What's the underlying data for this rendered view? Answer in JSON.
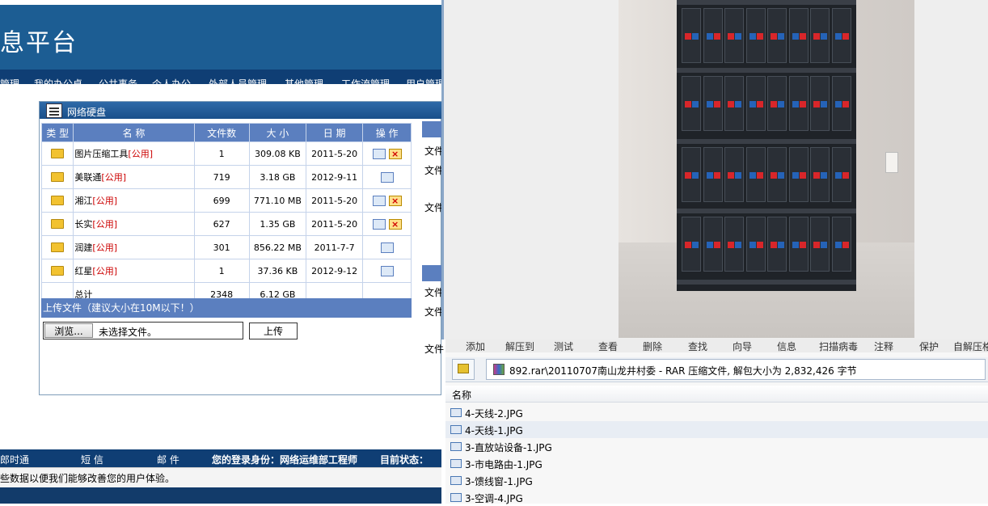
{
  "portal": {
    "banner_title": "息平台",
    "nav": [
      "管理",
      "我的办公桌",
      "公共事务",
      "个人办公",
      "外部人员管理",
      "其他管理",
      "工作流管理",
      "用户管理"
    ],
    "panel_title": "网络硬盘",
    "table": {
      "headers": [
        "类 型",
        "名 称",
        "文件数",
        "大 小",
        "日 期",
        "操 作"
      ],
      "rows": [
        {
          "name": "图片压缩工具",
          "tag": "[公用]",
          "count": "1",
          "size": "309.08 KB",
          "date": "2011-5-20",
          "can_delete": true
        },
        {
          "name": "美联通",
          "tag": "[公用]",
          "count": "719",
          "size": "3.18 GB",
          "date": "2012-9-11",
          "can_delete": false
        },
        {
          "name": "湘江",
          "tag": "[公用]",
          "count": "699",
          "size": "771.10 MB",
          "date": "2011-5-20",
          "can_delete": true
        },
        {
          "name": "长实",
          "tag": "[公用]",
          "count": "627",
          "size": "1.35 GB",
          "date": "2011-5-20",
          "can_delete": true
        },
        {
          "name": "润建",
          "tag": "[公用]",
          "count": "301",
          "size": "856.22 MB",
          "date": "2011-7-7",
          "can_delete": false
        },
        {
          "name": "红星",
          "tag": "[公用]",
          "count": "1",
          "size": "37.36 KB",
          "date": "2012-9-12",
          "can_delete": false
        }
      ],
      "total_label": "总计",
      "total_count": "2348",
      "total_size": "6.12 GB"
    },
    "upload": {
      "header": "上传文件（建议大小在10M以下！）",
      "browse_label": "浏览...",
      "file_status": "未选择文件。",
      "upload_label": "上传"
    },
    "side_labels": [
      "文件",
      "文件",
      "文件",
      "文件",
      "文件",
      "文件"
    ],
    "bottom_bar": {
      "im": "郎时通",
      "sms": "短 信",
      "mail": "邮 件",
      "login": "您的登录身份：网络运维部工程师",
      "status": "目前状态："
    },
    "info_text": "些数据以便我们能够改善您的用户体验。"
  },
  "archive": {
    "toolbar": [
      "添加",
      "解压到",
      "测试",
      "查看",
      "删除",
      "查找",
      "向导",
      "信息",
      "扫描病毒",
      "注释",
      "保护",
      "自解压格式"
    ],
    "path": "892.rar\\20110707南山龙井村委 - RAR 压缩文件, 解包大小为 2,832,426 字节",
    "column_name": "名称",
    "files": [
      "4-天线-2.JPG",
      "4-天线-1.JPG",
      "3-直放站设备-1.JPG",
      "3-市电路由-1.JPG",
      "3-馈线窗-1.JPG",
      "3-空调-4.JPG"
    ],
    "selected_index": 1
  }
}
